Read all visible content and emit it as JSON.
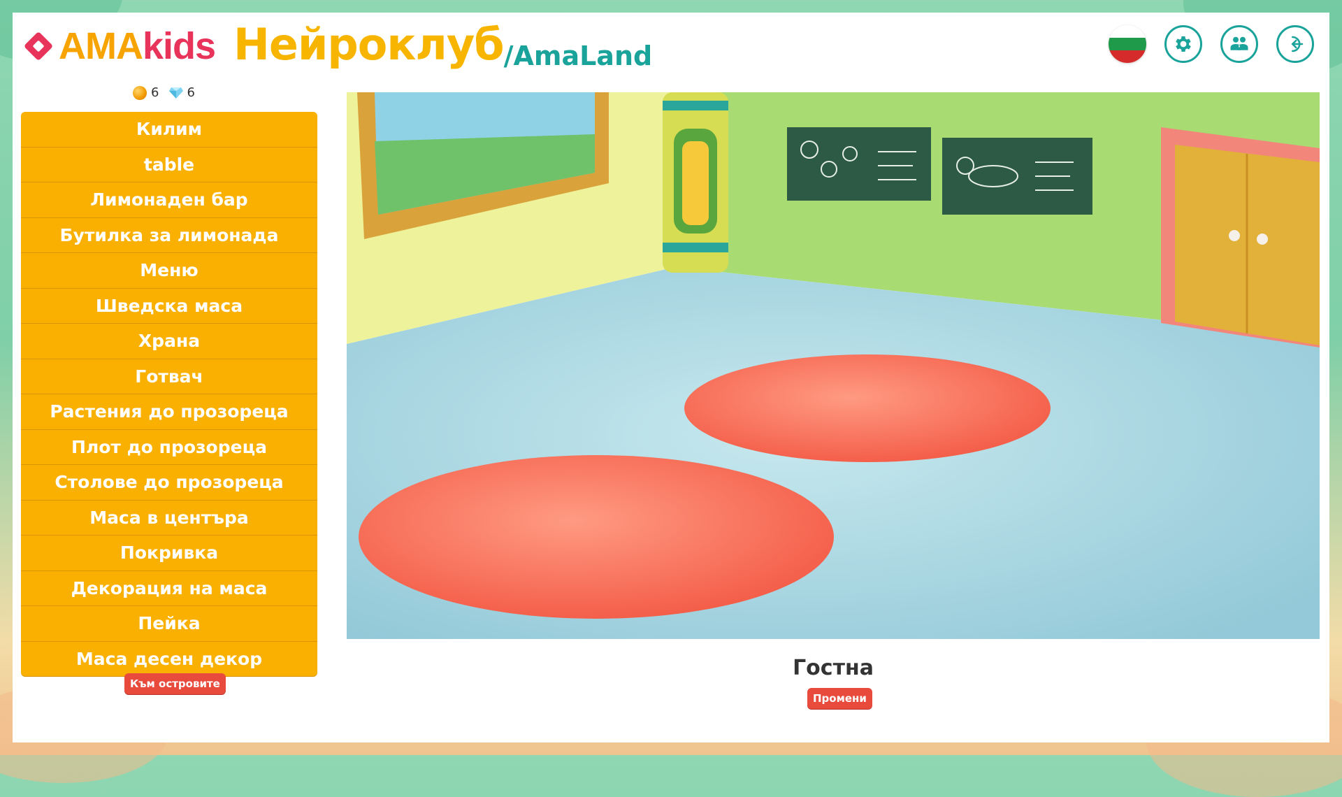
{
  "header": {
    "logo_ama": "AMA",
    "logo_kids": "kids",
    "brand_main": "Нейроклуб",
    "brand_sub": "/AmaLand",
    "icons": [
      "bulgarian-flag-icon",
      "settings-gear-icon",
      "users-icon",
      "logout-icon"
    ]
  },
  "currency": {
    "coins": "6",
    "gems": "6"
  },
  "menu": {
    "items": [
      {
        "label": "Килим"
      },
      {
        "label": "table"
      },
      {
        "label": "Лимонаден бар"
      },
      {
        "label": "Бутилка за лимонада"
      },
      {
        "label": "Меню"
      },
      {
        "label": "Шведска маса"
      },
      {
        "label": "Храна"
      },
      {
        "label": "Готвач"
      },
      {
        "label": "Растения до прозореца"
      },
      {
        "label": "Плот до прозореца"
      },
      {
        "label": "Столове до прозореца"
      },
      {
        "label": "Маса в центъра"
      },
      {
        "label": "Покривка"
      },
      {
        "label": "Декорация на маса"
      },
      {
        "label": "Пейка"
      },
      {
        "label": "Маса десен декор"
      }
    ],
    "to_islands_label": "Към островите"
  },
  "room": {
    "title": "Гостна",
    "change_label": "Промени"
  },
  "colors": {
    "menu": "#f9b000",
    "accent": "#1aa39a",
    "button_red": "#e84a3c",
    "brand_yellow": "#f7b500"
  }
}
